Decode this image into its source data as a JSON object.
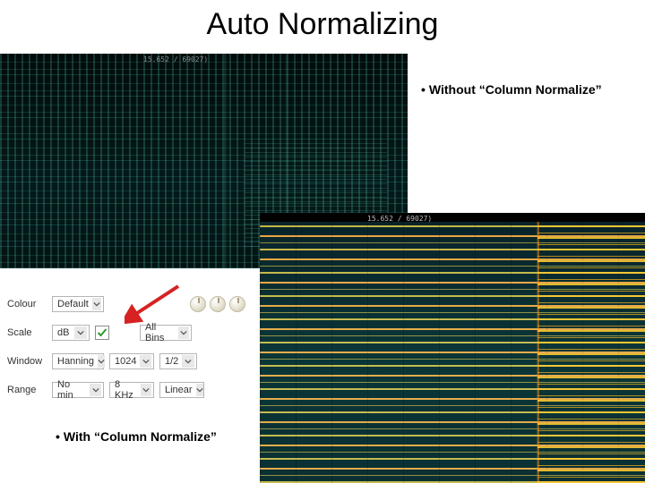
{
  "title": "Auto Normalizing",
  "captions": {
    "without": "Without “Column Normalize”",
    "with": "With “Column Normalize”",
    "bullet": "•"
  },
  "timecodes": {
    "dark": "15.652 / 69027)",
    "bright": "15.652 / 69027)"
  },
  "panel": {
    "rows": {
      "colour": {
        "label": "Colour",
        "value": "Default"
      },
      "scale": {
        "label": "Scale",
        "value": "dB",
        "checked": true,
        "bins": "All Bins"
      },
      "window": {
        "label": "Window",
        "value": "Hanning",
        "size": "1024",
        "overlap": "1/2"
      },
      "range": {
        "label": "Range",
        "min": "No min",
        "max": "8 KHz",
        "type": "Linear"
      }
    }
  }
}
